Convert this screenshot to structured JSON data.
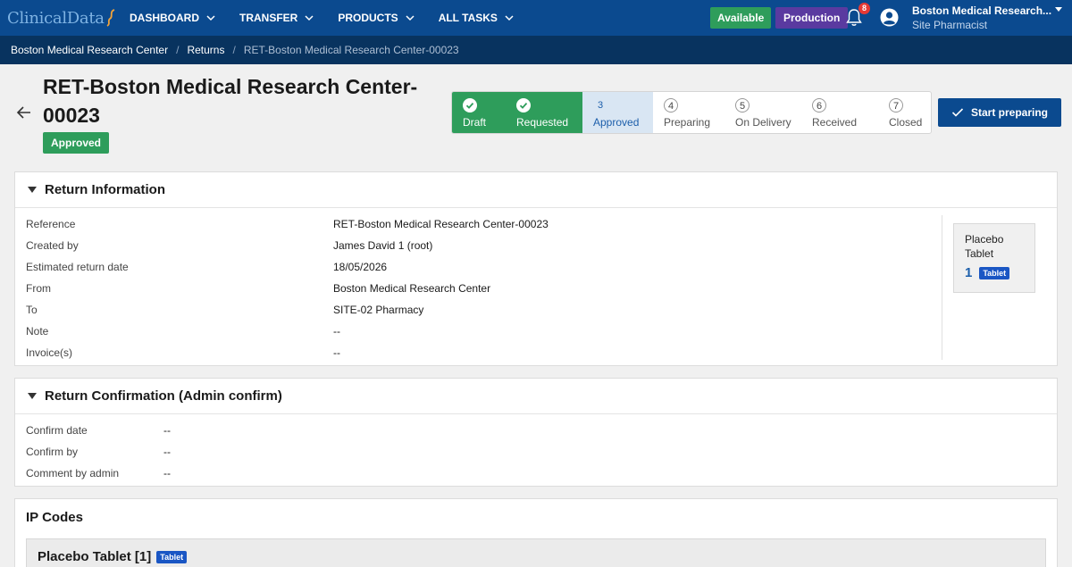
{
  "brand": {
    "logo_text": "ClinicalData"
  },
  "nav": {
    "items": [
      {
        "label": "DASHBOARD"
      },
      {
        "label": "TRANSFER"
      },
      {
        "label": "PRODUCTS"
      },
      {
        "label": "ALL TASKS"
      }
    ],
    "available_label": "Available",
    "production_label": "Production",
    "notification_count": "8",
    "user_name": "Boston Medical Research...",
    "user_role": "Site Pharmacist"
  },
  "breadcrumb": {
    "items": [
      "Boston Medical Research Center",
      "Returns",
      "RET-Boston Medical Research Center-00023"
    ],
    "separator": "/"
  },
  "header": {
    "title": "RET-Boston Medical Research Center-00023",
    "status": "Approved"
  },
  "stepper": {
    "steps": [
      {
        "num": "",
        "label": "Draft",
        "state": "done"
      },
      {
        "num": "",
        "label": "Requested",
        "state": "done"
      },
      {
        "num": "3",
        "label": "Approved",
        "state": "current"
      },
      {
        "num": "4",
        "label": "Preparing",
        "state": "todo"
      },
      {
        "num": "5",
        "label": "On Delivery",
        "state": "todo"
      },
      {
        "num": "6",
        "label": "Received",
        "state": "todo"
      },
      {
        "num": "7",
        "label": "Closed",
        "state": "todo"
      }
    ]
  },
  "actions": {
    "start_preparing": "Start preparing"
  },
  "return_info": {
    "title": "Return Information",
    "rows": [
      {
        "key": "Reference",
        "value": "RET-Boston Medical Research Center-00023"
      },
      {
        "key": "Created by",
        "value": "James David 1 (root)"
      },
      {
        "key": "Estimated return date",
        "value": "18/05/2026"
      },
      {
        "key": "From",
        "value": "Boston Medical Research Center"
      },
      {
        "key": "To",
        "value": "SITE-02 Pharmacy"
      },
      {
        "key": "Note",
        "value": "--"
      },
      {
        "key": "Invoice(s)",
        "value": "--"
      }
    ],
    "product": {
      "name": "Placebo Tablet",
      "qty": "1",
      "tag": "Tablet"
    }
  },
  "return_confirmation": {
    "title": "Return Confirmation (Admin confirm)",
    "rows": [
      {
        "key": "Confirm date",
        "value": "--"
      },
      {
        "key": "Confirm by",
        "value": "--"
      },
      {
        "key": "Comment by admin",
        "value": "--"
      }
    ]
  },
  "ip_codes": {
    "title": "IP Codes",
    "group_name": "Placebo Tablet [1]",
    "group_tag": "Tablet"
  },
  "colors": {
    "navbar": "#0b4a8f",
    "breadcrumb_bg": "#08335f",
    "success": "#2e9d5b",
    "production": "#5a3aa0",
    "link_blue": "#1d5fab"
  }
}
